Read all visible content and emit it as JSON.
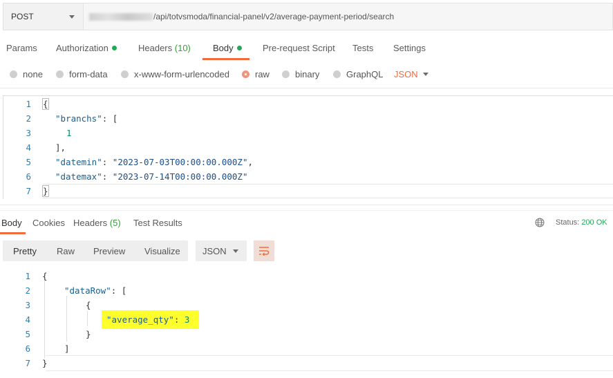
{
  "request": {
    "method": "POST",
    "url_visible": "/api/totvsmoda/financial-panel/v2/average-payment-period/search"
  },
  "request_tabs": [
    {
      "label": "Params"
    },
    {
      "label": "Authorization"
    },
    {
      "label": "Headers",
      "count": "(10)"
    },
    {
      "label": "Body"
    },
    {
      "label": "Pre-request Script"
    },
    {
      "label": "Tests"
    },
    {
      "label": "Settings"
    }
  ],
  "active_request_tab": "Body",
  "body_types": [
    "none",
    "form-data",
    "x-www-form-urlencoded",
    "raw",
    "binary",
    "GraphQL"
  ],
  "selected_body_type": "raw",
  "raw_format": "JSON",
  "request_body_lines": [
    {
      "n": "1",
      "text": "{"
    },
    {
      "n": "2",
      "key": "\"branchs\"",
      "rest": ": ["
    },
    {
      "n": "3",
      "num": "1"
    },
    {
      "n": "4",
      "text": "],"
    },
    {
      "n": "5",
      "key": "\"datemin\"",
      "str": "\"2023-07-03T00:00:00.000Z\"",
      "tail": ","
    },
    {
      "n": "6",
      "key": "\"datemax\"",
      "str": "\"2023-07-14T00:00:00.000Z\""
    },
    {
      "n": "7",
      "text": "}"
    }
  ],
  "response_tabs": [
    {
      "label": "Body"
    },
    {
      "label": "Cookies"
    },
    {
      "label": "Headers",
      "count": "(5)"
    },
    {
      "label": "Test Results"
    }
  ],
  "status": {
    "label": "Status:",
    "value": "200 OK"
  },
  "view_modes": [
    "Pretty",
    "Raw",
    "Preview",
    "Visualize"
  ],
  "response_format": "JSON",
  "response_body_lines": [
    {
      "n": "1",
      "text": "{"
    },
    {
      "n": "2",
      "key": "\"dataRow\"",
      "rest": ": ["
    },
    {
      "n": "3",
      "text": "{"
    },
    {
      "n": "4",
      "key": "\"average_qty\"",
      "rest": ": ",
      "num": "3"
    },
    {
      "n": "5",
      "text": "}"
    },
    {
      "n": "6",
      "text": "]"
    },
    {
      "n": "7",
      "text": "}"
    }
  ],
  "colors": {
    "accent": "#f26b3a",
    "status_ok": "#25a35a",
    "highlight": "#ffff2e"
  }
}
